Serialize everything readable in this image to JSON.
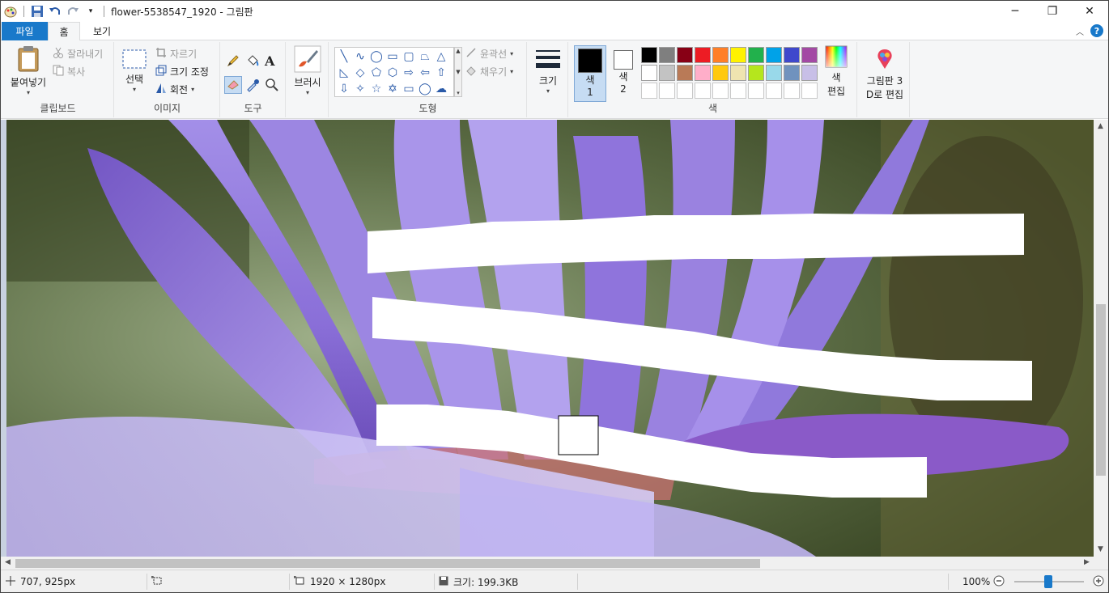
{
  "title": "flower-5538547_1920 - 그림판",
  "window_controls": {
    "minimize": "─",
    "maximize": "❐",
    "close": "✕"
  },
  "tabs": {
    "file": "파일",
    "home": "홈",
    "view": "보기"
  },
  "clipboard": {
    "paste": "붙여넣기",
    "cut": "잘라내기",
    "copy": "복사",
    "label": "클립보드"
  },
  "image": {
    "select": "선택",
    "crop": "자르기",
    "resize": "크기 조정",
    "rotate": "회전",
    "label": "이미지"
  },
  "tools": {
    "label": "도구",
    "text_glyph": "A"
  },
  "brushes": {
    "label": "브러시"
  },
  "shapes": {
    "outline": "윤곽선",
    "fill": "채우기",
    "label": "도형"
  },
  "size": {
    "label": "크기"
  },
  "colors": {
    "color1_label": "색",
    "color1_num": "1",
    "color2_label": "색",
    "color2_num": "2",
    "edit_colors_1": "색",
    "edit_colors_2": "편집",
    "label": "색",
    "color1": "#000000",
    "color2": "#ffffff",
    "palette_row1": [
      "#000000",
      "#7f7f7f",
      "#880015",
      "#ed1c24",
      "#ff7f27",
      "#fff200",
      "#22b14c",
      "#00a2e8",
      "#3f48cc",
      "#a349a4"
    ],
    "palette_row2": [
      "#ffffff",
      "#c3c3c3",
      "#b97a57",
      "#ffaec9",
      "#ffc90e",
      "#efe4b0",
      "#b5e61d",
      "#99d9ea",
      "#7092be",
      "#c8bfe7"
    ]
  },
  "paint3d": {
    "line1": "그림판 3",
    "line2": "D로 편집"
  },
  "status": {
    "cursor_pos": "707, 925px",
    "image_size": "1920 × 1280px",
    "file_size": "크기: 199.3KB",
    "zoom": "100%"
  }
}
